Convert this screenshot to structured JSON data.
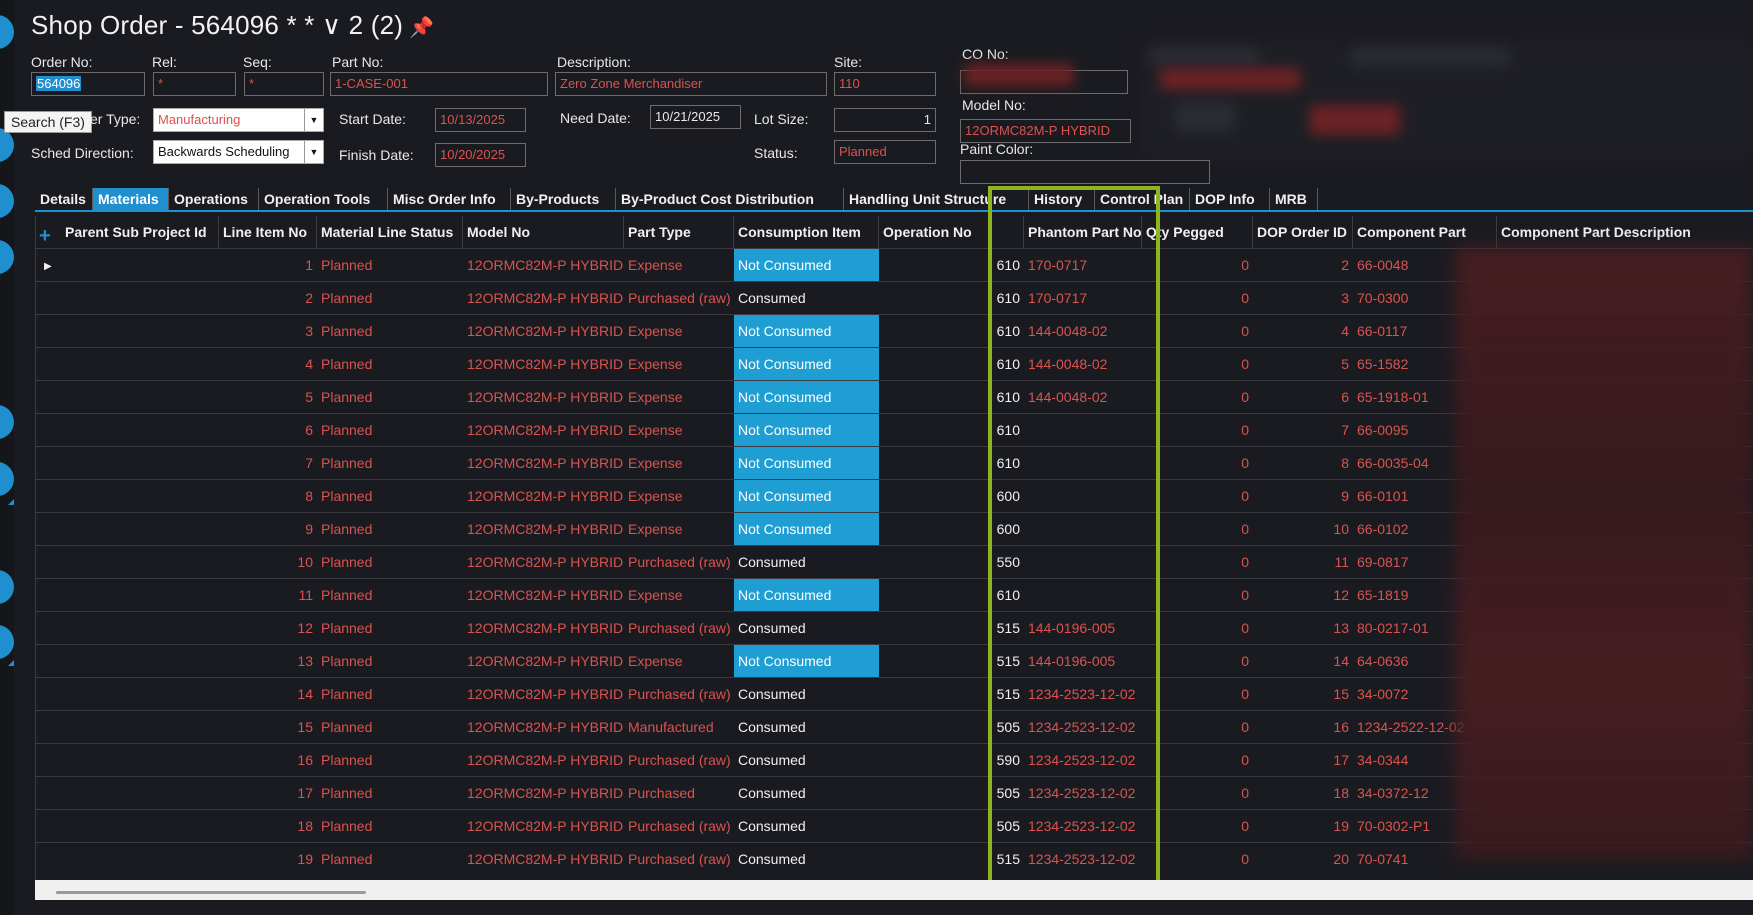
{
  "title": {
    "text": "Shop Order - 564096 * * ∨ 2 (2)",
    "pin": "📌"
  },
  "tooltip": "Search (F3)",
  "header": {
    "order_no_label": "Order No:",
    "order_no": "564096",
    "rel_label": "Rel:",
    "rel": "*",
    "seq_label": "Seq:",
    "seq": "*",
    "part_no_label": "Part No:",
    "part_no": "1-CASE-001",
    "description_label": "Description:",
    "description": "Zero Zone Merchandiser",
    "site_label": "Site:",
    "site": "110",
    "co_no_label": "CO No:",
    "model_no_label": "Model No:",
    "model_no": "12ORMC82M-P HYBRID",
    "paint_color_label": "Paint Color:",
    "order_type_label": "er Type:",
    "order_type": "Manufacturing",
    "start_date_label": "Start Date:",
    "start_date": "10/13/2025",
    "need_date_label": "Need Date:",
    "need_date": "10/21/2025",
    "lot_size_label": "Lot Size:",
    "lot_size": "1",
    "sched_direction_label": "Sched Direction:",
    "sched_direction": "Backwards Scheduling",
    "finish_date_label": "Finish Date:",
    "finish_date": "10/20/2025",
    "status_label": "Status:",
    "status": "Planned"
  },
  "tabs": [
    "Details",
    "Materials",
    "Operations",
    "Operation Tools",
    "Misc Order Info",
    "By-Products",
    "By-Product Cost Distribution",
    "Handling Unit Structure",
    "History",
    "Control Plan",
    "DOP Info",
    "MRB"
  ],
  "active_tab": "Materials",
  "grid": {
    "columns": [
      "Parent Sub Project Id",
      "Line Item No",
      "Material Line Status",
      "Model No",
      "Part Type",
      "Consumption Item",
      "Operation No",
      "Phantom Part No",
      "Qty Pegged",
      "DOP Order ID",
      "Component Part",
      "Component Part Description"
    ],
    "rows": [
      {
        "line": "1",
        "status": "Planned",
        "model": "12ORMC82M-P HYBRID",
        "type": "Expense",
        "consumption": "Not Consumed",
        "op": "610",
        "phantom": "170-0717",
        "qty": "0",
        "dop": "2",
        "comp": "66-0048"
      },
      {
        "line": "2",
        "status": "Planned",
        "model": "12ORMC82M-P HYBRID",
        "type": "Purchased (raw)",
        "consumption": "Consumed",
        "op": "610",
        "phantom": "170-0717",
        "qty": "0",
        "dop": "3",
        "comp": "70-0300"
      },
      {
        "line": "3",
        "status": "Planned",
        "model": "12ORMC82M-P HYBRID",
        "type": "Expense",
        "consumption": "Not Consumed",
        "op": "610",
        "phantom": "144-0048-02",
        "qty": "0",
        "dop": "4",
        "comp": "66-0117"
      },
      {
        "line": "4",
        "status": "Planned",
        "model": "12ORMC82M-P HYBRID",
        "type": "Expense",
        "consumption": "Not Consumed",
        "op": "610",
        "phantom": "144-0048-02",
        "qty": "0",
        "dop": "5",
        "comp": "65-1582"
      },
      {
        "line": "5",
        "status": "Planned",
        "model": "12ORMC82M-P HYBRID",
        "type": "Expense",
        "consumption": "Not Consumed",
        "op": "610",
        "phantom": "144-0048-02",
        "qty": "0",
        "dop": "6",
        "comp": "65-1918-01"
      },
      {
        "line": "6",
        "status": "Planned",
        "model": "12ORMC82M-P HYBRID",
        "type": "Expense",
        "consumption": "Not Consumed",
        "op": "610",
        "phantom": "",
        "qty": "0",
        "dop": "7",
        "comp": "66-0095"
      },
      {
        "line": "7",
        "status": "Planned",
        "model": "12ORMC82M-P HYBRID",
        "type": "Expense",
        "consumption": "Not Consumed",
        "op": "610",
        "phantom": "",
        "qty": "0",
        "dop": "8",
        "comp": "66-0035-04"
      },
      {
        "line": "8",
        "status": "Planned",
        "model": "12ORMC82M-P HYBRID",
        "type": "Expense",
        "consumption": "Not Consumed",
        "op": "600",
        "phantom": "",
        "qty": "0",
        "dop": "9",
        "comp": "66-0101"
      },
      {
        "line": "9",
        "status": "Planned",
        "model": "12ORMC82M-P HYBRID",
        "type": "Expense",
        "consumption": "Not Consumed",
        "op": "600",
        "phantom": "",
        "qty": "0",
        "dop": "10",
        "comp": "66-0102"
      },
      {
        "line": "10",
        "status": "Planned",
        "model": "12ORMC82M-P HYBRID",
        "type": "Purchased (raw)",
        "consumption": "Consumed",
        "op": "550",
        "phantom": "",
        "qty": "0",
        "dop": "11",
        "comp": "69-0817"
      },
      {
        "line": "11",
        "status": "Planned",
        "model": "12ORMC82M-P HYBRID",
        "type": "Expense",
        "consumption": "Not Consumed",
        "op": "610",
        "phantom": "",
        "qty": "0",
        "dop": "12",
        "comp": "65-1819"
      },
      {
        "line": "12",
        "status": "Planned",
        "model": "12ORMC82M-P HYBRID",
        "type": "Purchased (raw)",
        "consumption": "Consumed",
        "op": "515",
        "phantom": "144-0196-005",
        "qty": "0",
        "dop": "13",
        "comp": "80-0217-01"
      },
      {
        "line": "13",
        "status": "Planned",
        "model": "12ORMC82M-P HYBRID",
        "type": "Expense",
        "consumption": "Not Consumed",
        "op": "515",
        "phantom": "144-0196-005",
        "qty": "0",
        "dop": "14",
        "comp": "64-0636"
      },
      {
        "line": "14",
        "status": "Planned",
        "model": "12ORMC82M-P HYBRID",
        "type": "Purchased (raw)",
        "consumption": "Consumed",
        "op": "515",
        "phantom": "1234-2523-12-02",
        "qty": "0",
        "dop": "15",
        "comp": "34-0072"
      },
      {
        "line": "15",
        "status": "Planned",
        "model": "12ORMC82M-P HYBRID",
        "type": "Manufactured",
        "consumption": "Consumed",
        "op": "505",
        "phantom": "1234-2523-12-02",
        "qty": "0",
        "dop": "16",
        "comp": "1234-2522-12-02"
      },
      {
        "line": "16",
        "status": "Planned",
        "model": "12ORMC82M-P HYBRID",
        "type": "Purchased (raw)",
        "consumption": "Consumed",
        "op": "590",
        "phantom": "1234-2523-12-02",
        "qty": "0",
        "dop": "17",
        "comp": "34-0344"
      },
      {
        "line": "17",
        "status": "Planned",
        "model": "12ORMC82M-P HYBRID",
        "type": "Purchased",
        "consumption": "Consumed",
        "op": "505",
        "phantom": "1234-2523-12-02",
        "qty": "0",
        "dop": "18",
        "comp": "34-0372-12"
      },
      {
        "line": "18",
        "status": "Planned",
        "model": "12ORMC82M-P HYBRID",
        "type": "Purchased (raw)",
        "consumption": "Consumed",
        "op": "505",
        "phantom": "1234-2523-12-02",
        "qty": "0",
        "dop": "19",
        "comp": "70-0302-P1"
      },
      {
        "line": "19",
        "status": "Planned",
        "model": "12ORMC82M-P HYBRID",
        "type": "Purchased (raw)",
        "consumption": "Consumed",
        "op": "515",
        "phantom": "1234-2523-12-02",
        "qty": "0",
        "dop": "20",
        "comp": "70-0741"
      }
    ]
  },
  "icons": {
    "add": "plus-icon",
    "row_pointer": "current-row-arrow-icon",
    "dropdown": "chevron-down-icon",
    "pin": "pin-icon"
  },
  "colors": {
    "accent": "#1f8fd0",
    "highlight_box": "#8db51e",
    "red_text": "#d9534f",
    "not_consumed_bg": "#1f9ed3"
  }
}
